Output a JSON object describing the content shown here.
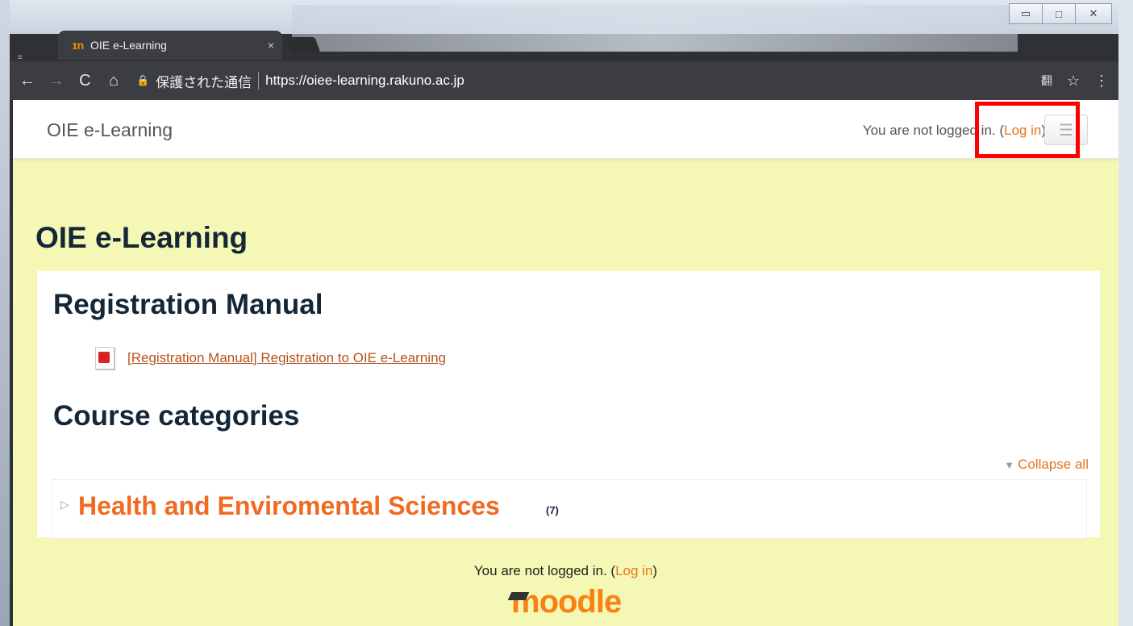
{
  "browser": {
    "tab_title": "OIE e-Learning",
    "tab_favicon": "ɪn",
    "tab_close": "×",
    "secure_label": "保護された通信",
    "url": "https://oiee-learning.rakuno.ac.jp",
    "nav": {
      "back": "←",
      "forward": "→",
      "reload": "C",
      "home": "⌂"
    },
    "translate_icon": "翻",
    "star_icon": "☆",
    "menu_icon": "⋮"
  },
  "window_controls": {
    "minimize": "▭",
    "maximize": "□",
    "close": "✕"
  },
  "navbar": {
    "brand": "OIE e-Learning",
    "not_logged_prefix": "You are not logged in. (",
    "login_link": "Log in",
    "not_logged_suffix": ")",
    "menu_icon": "☰"
  },
  "page": {
    "title": "OIE e-Learning",
    "section_registration": "Registration Manual",
    "file_link": "[Registration Manual] Registration to OIE e-Learning",
    "section_categories": "Course categories",
    "collapse_all": "Collapse all",
    "categories": [
      {
        "name": "Health and Enviromental Sciences",
        "count": "(7)"
      }
    ]
  },
  "footer": {
    "not_logged_prefix": "You are not logged in. (",
    "login_link": "Log in",
    "not_logged_suffix": ")",
    "logo": "moodle"
  },
  "colors": {
    "page_background": "#f5f7b5",
    "link_orange": "#e6741f",
    "category_orange": "#f16a22",
    "heading_dark": "#142738",
    "highlight_red": "#ff0000"
  }
}
